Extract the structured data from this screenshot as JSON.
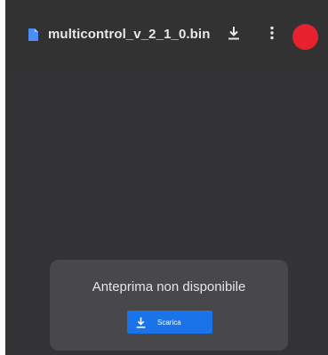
{
  "header": {
    "file_icon": "file-icon",
    "file_name": "multicontrol_v_2_1_0.bin",
    "download_icon": "download-icon",
    "more_icon": "more-vert-icon",
    "avatar_color": "#e8212e"
  },
  "preview": {
    "message": "Anteprima non disponibile",
    "button_label": "Scarica",
    "button_icon": "download-icon",
    "button_color": "#1a73e8"
  }
}
